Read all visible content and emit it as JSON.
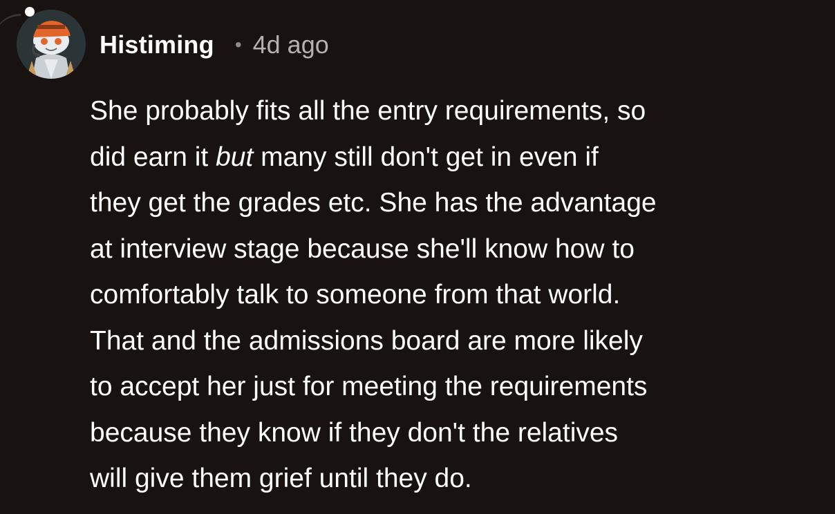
{
  "comment": {
    "author": "Histiming",
    "separator": "•",
    "timestamp": "4d ago",
    "avatar_icon": "snoo-avatar-icon",
    "body": {
      "line1": "She probably fits all the entry requirements, so",
      "line2_pre": "did earn it ",
      "line2_em": "but",
      "line2_post": " many still don't get in even if",
      "line3": "they get the grades etc. She has the advantage",
      "line4": "at interview stage because she'll know how to",
      "line5": "comfortably talk to someone from that world.",
      "line6": "That and the admissions board are more likely",
      "line7": "to accept her just for meeting the requirements",
      "line8": "because they know if they don't the relatives",
      "line9": "will give them grief until they do."
    }
  },
  "colors": {
    "background": "#181210",
    "text": "#ffffff",
    "muted": "#b5b1ae"
  }
}
